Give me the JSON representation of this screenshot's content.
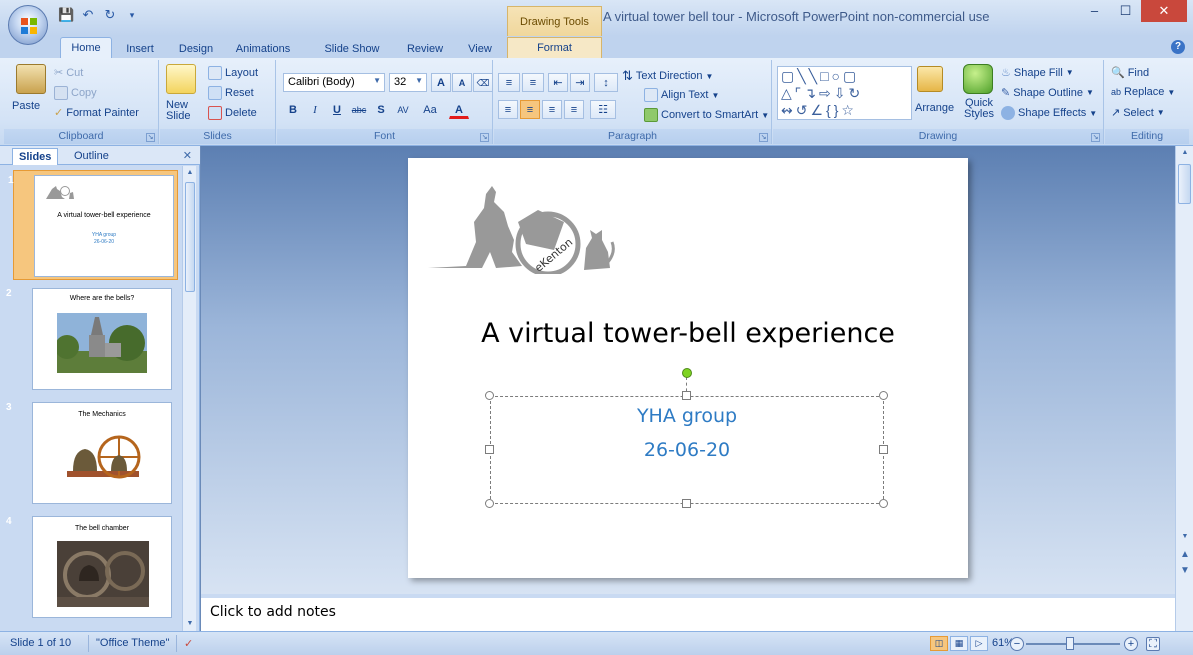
{
  "window": {
    "title": "A virtual tower bell tour - Microsoft PowerPoint non-commercial use",
    "contextual_tab": "Drawing Tools"
  },
  "tabs": [
    "Home",
    "Insert",
    "Design",
    "Animations",
    "Slide Show",
    "Review",
    "View",
    "Format"
  ],
  "ribbon": {
    "clipboard": {
      "label": "Clipboard",
      "paste": "Paste",
      "cut": "Cut",
      "copy": "Copy",
      "format_painter": "Format Painter"
    },
    "slides": {
      "label": "Slides",
      "new_slide": "New Slide",
      "layout": "Layout",
      "reset": "Reset",
      "delete": "Delete"
    },
    "font": {
      "label": "Font",
      "family": "Calibri (Body)",
      "size": "32"
    },
    "paragraph": {
      "label": "Paragraph",
      "text_direction": "Text Direction",
      "align_text": "Align Text",
      "convert_smartart": "Convert to SmartArt"
    },
    "drawing": {
      "label": "Drawing",
      "arrange": "Arrange",
      "quick_styles": "Quick Styles",
      "shape_fill": "Shape Fill",
      "shape_outline": "Shape Outline",
      "shape_effects": "Shape Effects"
    },
    "editing": {
      "label": "Editing",
      "find": "Find",
      "replace": "Replace",
      "select": "Select"
    }
  },
  "pane": {
    "tab_slides": "Slides",
    "tab_outline": "Outline",
    "thumbnails": [
      {
        "num": "1",
        "title": "A virtual tower-bell experience",
        "sub1": "YHA group",
        "sub2": "26-06-20"
      },
      {
        "num": "2",
        "title": "Where are the bells?"
      },
      {
        "num": "3",
        "title": "The Mechanics"
      },
      {
        "num": "4",
        "title": "The bell chamber"
      }
    ]
  },
  "slide": {
    "title": "A virtual tower-bell experience",
    "subtitle_line1": "YHA group",
    "subtitle_line2": "26-06-20",
    "logo_text": "eKenton"
  },
  "notes": {
    "placeholder": "Click to add notes"
  },
  "status": {
    "slide_pos": "Slide 1 of 10",
    "theme": "\"Office Theme\"",
    "zoom": "61%"
  },
  "colors": {
    "subtitle": "#2e7bc4",
    "selection": "#f6c67e"
  }
}
